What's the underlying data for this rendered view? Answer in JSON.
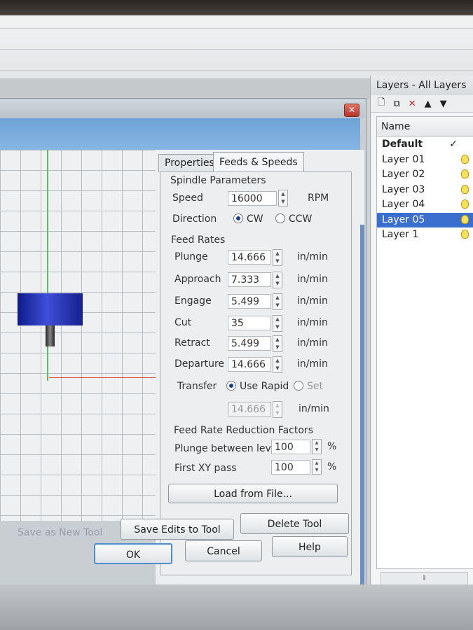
{
  "layers": {
    "title": "Layers - All Layers",
    "toolbar": [
      "new-layer-icon",
      "copy-layer-icon",
      "delete-icon",
      "move-up-icon",
      "move-down-icon"
    ],
    "column_header": "Name",
    "items": [
      {
        "label": "Default",
        "current": true
      },
      {
        "label": "Layer 01"
      },
      {
        "label": "Layer 02"
      },
      {
        "label": "Layer 03"
      },
      {
        "label": "Layer 04"
      },
      {
        "label": "Layer 05",
        "selected": true
      },
      {
        "label": "Layer 1"
      }
    ],
    "check_glyph": "✓",
    "scroll_grip": "⦀"
  },
  "dialog": {
    "tabs": [
      "Properties",
      "Feeds & Speeds"
    ],
    "active_tab": "Feeds & Speeds",
    "spindle": {
      "section": "Spindle Parameters",
      "speed_label": "Speed",
      "speed_value": "16000",
      "speed_unit": "RPM",
      "direction_label": "Direction",
      "cw": "CW",
      "ccw": "CCW",
      "direction_selected": "CW"
    },
    "feed_rates": {
      "section": "Feed Rates",
      "unit": "in/min",
      "rows": [
        {
          "label": "Plunge",
          "value": "14.666"
        },
        {
          "label": "Approach",
          "value": "7.333"
        },
        {
          "label": "Engage",
          "value": "5.499"
        },
        {
          "label": "Cut",
          "value": "35"
        },
        {
          "label": "Retract",
          "value": "5.499"
        },
        {
          "label": "Departure",
          "value": "14.666"
        }
      ],
      "transfer_label": "Transfer",
      "use_rapid": "Use Rapid",
      "set": "Set",
      "transfer_selected": "Use Rapid",
      "transfer_value": "14.666",
      "transfer_unit": "in/min"
    },
    "reduction": {
      "section": "Feed Rate Reduction Factors",
      "plunge_label": "Plunge between levels",
      "plunge_value": "100",
      "first_label": "First XY pass",
      "first_value": "100",
      "unit": "%"
    },
    "buttons": {
      "load": "Load from File...",
      "save_new": "Save as New Tool",
      "save_edits": "Save Edits to Tool",
      "delete": "Delete Tool",
      "ok": "OK",
      "cancel": "Cancel",
      "help": "Help"
    },
    "close_glyph": "✕"
  },
  "colors": {
    "selection": "#3a6fcf",
    "tool": "#2430b8",
    "axis_x": "#d64b3a",
    "axis_y": "#57c057"
  }
}
